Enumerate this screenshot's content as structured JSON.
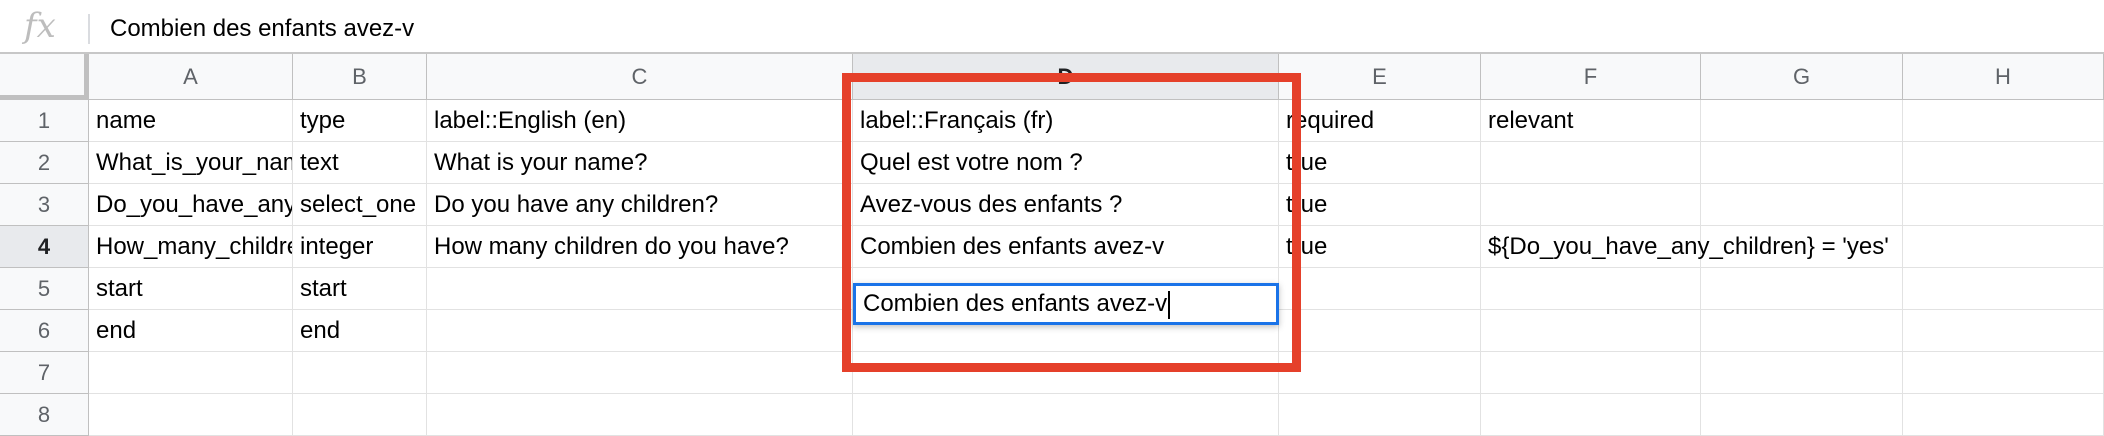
{
  "formula_bar": {
    "fx_label": "fx",
    "value": "Combien des enfants avez-v"
  },
  "columns": [
    "A",
    "B",
    "C",
    "D",
    "E",
    "F",
    "G",
    "H"
  ],
  "selected_column": "D",
  "rows": [
    "1",
    "2",
    "3",
    "4",
    "5",
    "6",
    "7",
    "8"
  ],
  "selected_row": "4",
  "cells": {
    "r1": {
      "A": "name",
      "B": "type",
      "C": "label::English (en)",
      "D": "label::Français (fr)",
      "E": "required",
      "F": "relevant"
    },
    "r2": {
      "A": "What_is_your_name",
      "B": "text",
      "C": "What is your name?",
      "D": "Quel est votre nom ?",
      "E": "true",
      "F": ""
    },
    "r3": {
      "A": "Do_you_have_any_children",
      "B": "select_one",
      "C": "Do you have any children?",
      "D": "Avez-vous des enfants ?",
      "E": "true",
      "F": ""
    },
    "r4": {
      "A": "How_many_children",
      "B": "integer",
      "C": "How many children do you have?",
      "D": "Combien des enfants avez-v",
      "E": "true",
      "F": "${Do_you_have_any_children} = 'yes'"
    },
    "r5": {
      "A": "start",
      "B": "start"
    },
    "r6": {
      "A": "end",
      "B": "end"
    }
  },
  "colors": {
    "highlight_box": "#e5402a",
    "active_cell_border": "#1a73e8"
  }
}
